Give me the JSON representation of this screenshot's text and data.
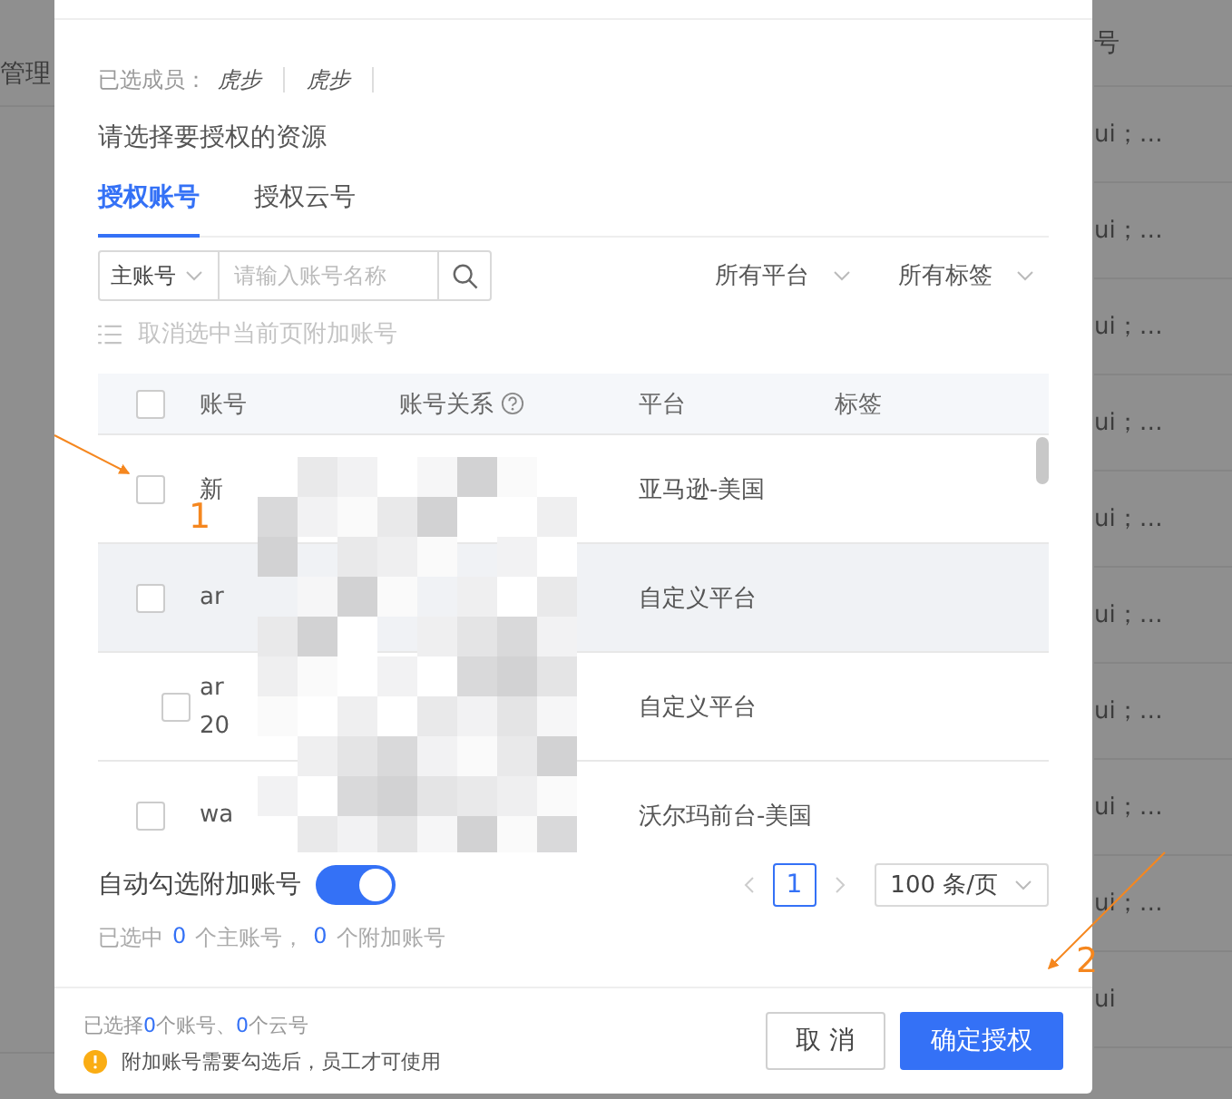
{
  "background": {
    "left_header": "管理",
    "right_header": "号",
    "right_rows": [
      "ui；…",
      "ui；…",
      "ui；…",
      "ui；…",
      "ui；…",
      "ui；…",
      "ui；…",
      "ui；…",
      "ui；…",
      "ui"
    ]
  },
  "members": {
    "label": "已选成员：",
    "names": [
      "虎步",
      "虎步"
    ]
  },
  "prompt": "请选择要授权的资源",
  "tabs": [
    {
      "label": "授权账号",
      "selected": true
    },
    {
      "label": "授权云号",
      "selected": false
    }
  ],
  "search": {
    "scope": "主账号",
    "placeholder": "请输入账号名称"
  },
  "filters": [
    "所有平台",
    "所有标签"
  ],
  "deselect_action": {
    "label": "取消选中当前页附加账号",
    "disabled": true
  },
  "table": {
    "header_checked": false,
    "columns": [
      "账号",
      "账号关系",
      "平台",
      "标签"
    ],
    "rows": [
      {
        "account_lines": [
          "新"
        ],
        "platform": "亚马逊-美国",
        "checked": false,
        "hovered": false
      },
      {
        "account_lines": [
          "ar"
        ],
        "platform": "自定义平台",
        "checked": false,
        "hovered": true,
        "children": [
          {
            "account_lines": [
              "ar",
              "20"
            ],
            "platform": "自定义平台",
            "checked": false,
            "hovered": false
          }
        ]
      },
      {
        "account_lines": [
          "wa"
        ],
        "platform": "沃尔玛前台-美国",
        "checked": false,
        "hovered": false
      }
    ]
  },
  "auto_select": {
    "label": "自动勾选附加账号",
    "on": true
  },
  "pagination": {
    "current": "1",
    "page_size": "100 条/页"
  },
  "selected_summary": [
    {
      "kind": "text",
      "text": "已选中"
    },
    {
      "kind": "count",
      "text": "0"
    },
    {
      "kind": "text",
      "text": "个主账号，"
    },
    {
      "kind": "count",
      "text": "0"
    },
    {
      "kind": "text",
      "text": "个附加账号"
    }
  ],
  "footer": {
    "summary": [
      {
        "kind": "text",
        "text": "已选择"
      },
      {
        "kind": "count",
        "text": "0"
      },
      {
        "kind": "text",
        "text": "个账号、"
      },
      {
        "kind": "count",
        "text": "0"
      },
      {
        "kind": "text",
        "text": "个云号"
      }
    ],
    "warning": "附加账号需要勾选后，员工才可使用",
    "buttons": [
      {
        "label": "取 消",
        "kind": "default"
      },
      {
        "label": "确定授权",
        "kind": "primary"
      }
    ]
  },
  "annotations": [
    {
      "label": "1"
    },
    {
      "label": "2"
    }
  ]
}
